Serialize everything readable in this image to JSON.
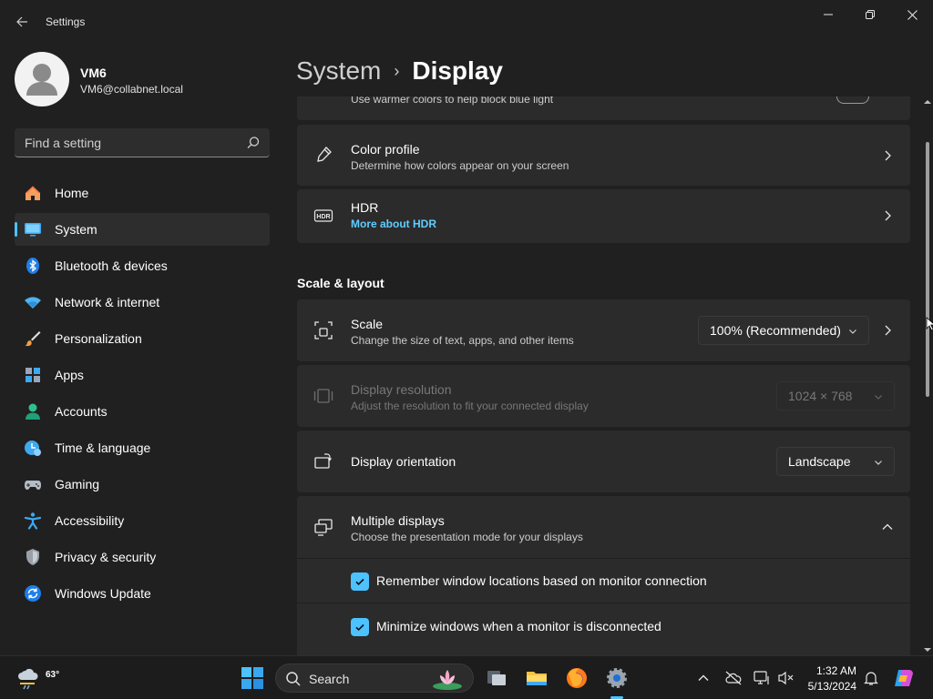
{
  "window": {
    "title": "Settings"
  },
  "user": {
    "name": "VM6",
    "email": "VM6@collabnet.local"
  },
  "search": {
    "placeholder": "Find a setting"
  },
  "sidebar": {
    "items": [
      {
        "label": "Home",
        "icon": "home-icon"
      },
      {
        "label": "System",
        "icon": "system-icon",
        "active": true
      },
      {
        "label": "Bluetooth & devices",
        "icon": "bluetooth-icon"
      },
      {
        "label": "Network & internet",
        "icon": "network-icon"
      },
      {
        "label": "Personalization",
        "icon": "personalization-icon"
      },
      {
        "label": "Apps",
        "icon": "apps-icon"
      },
      {
        "label": "Accounts",
        "icon": "accounts-icon"
      },
      {
        "label": "Time & language",
        "icon": "time-language-icon"
      },
      {
        "label": "Gaming",
        "icon": "gaming-icon"
      },
      {
        "label": "Accessibility",
        "icon": "accessibility-icon"
      },
      {
        "label": "Privacy & security",
        "icon": "privacy-icon"
      },
      {
        "label": "Windows Update",
        "icon": "windows-update-icon"
      }
    ]
  },
  "breadcrumb": {
    "parent": "System",
    "separator": "›",
    "current": "Display"
  },
  "main": {
    "night_light": {
      "subtitle": "Use warmer colors to help block blue light"
    },
    "color_profile": {
      "title": "Color profile",
      "subtitle": "Determine how colors appear on your screen"
    },
    "hdr": {
      "title": "HDR",
      "link": "More about HDR",
      "icon_text": "HDR"
    },
    "scale_layout": {
      "section_title": "Scale & layout",
      "scale": {
        "title": "Scale",
        "subtitle": "Change the size of text, apps, and other items",
        "value": "100% (Recommended)"
      },
      "resolution": {
        "title": "Display resolution",
        "subtitle": "Adjust the resolution to fit your connected display",
        "value": "1024 × 768",
        "disabled": true
      },
      "orientation": {
        "title": "Display orientation",
        "value": "Landscape"
      },
      "multiple_displays": {
        "title": "Multiple displays",
        "subtitle": "Choose the presentation mode for your displays",
        "expanded": true,
        "options": [
          {
            "label": "Remember window locations based on monitor connection",
            "checked": true
          },
          {
            "label": "Minimize windows when a monitor is disconnected",
            "checked": true
          }
        ]
      }
    }
  },
  "taskbar": {
    "weather_temp": "63°",
    "search_label": "Search",
    "clock_time": "1:32 AM",
    "clock_date": "5/13/2024"
  },
  "colors": {
    "accent": "#4cc2ff",
    "link": "#60cdff",
    "background": "#202020",
    "card": "#2b2b2b"
  }
}
